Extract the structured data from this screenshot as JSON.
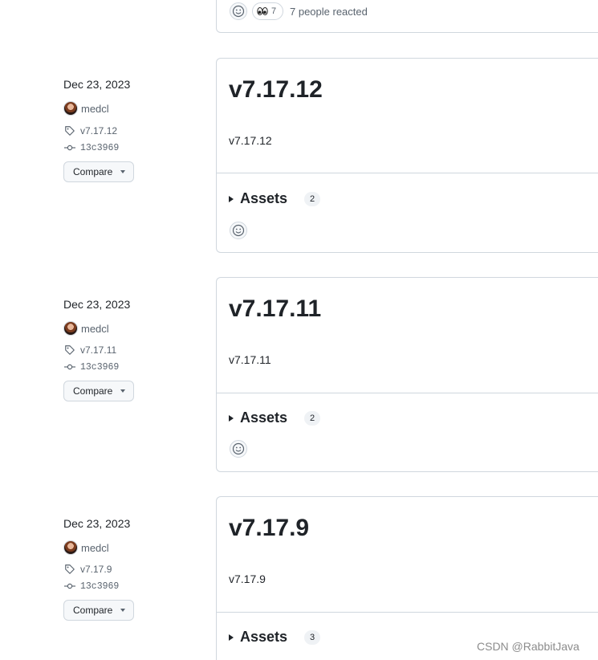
{
  "top_reactions": {
    "eyes_count": "7",
    "summary": "7 people reacted"
  },
  "releases": [
    {
      "date": "Dec 23, 2023",
      "author": "medcl",
      "tag": "v7.17.12",
      "commit": "13c3969",
      "compare_label": "Compare",
      "title": "v7.17.12",
      "body": "v7.17.12",
      "assets_label": "Assets",
      "assets_count": "2"
    },
    {
      "date": "Dec 23, 2023",
      "author": "medcl",
      "tag": "v7.17.11",
      "commit": "13c3969",
      "compare_label": "Compare",
      "title": "v7.17.11",
      "body": "v7.17.11",
      "assets_label": "Assets",
      "assets_count": "2"
    },
    {
      "date": "Dec 23, 2023",
      "author": "medcl",
      "tag": "v7.17.9",
      "commit": "13c3969",
      "compare_label": "Compare",
      "title": "v7.17.9",
      "body": "v7.17.9",
      "assets_label": "Assets",
      "assets_count": "3"
    }
  ],
  "icons": {
    "smiley": "smiley-icon",
    "eyes": "eyes-emoji-icon",
    "tag": "tag-icon",
    "commit": "git-commit-icon",
    "caret": "triangle-down-icon",
    "disclosure": "triangle-right-icon"
  },
  "watermark": "CSDN @RabbitJava"
}
